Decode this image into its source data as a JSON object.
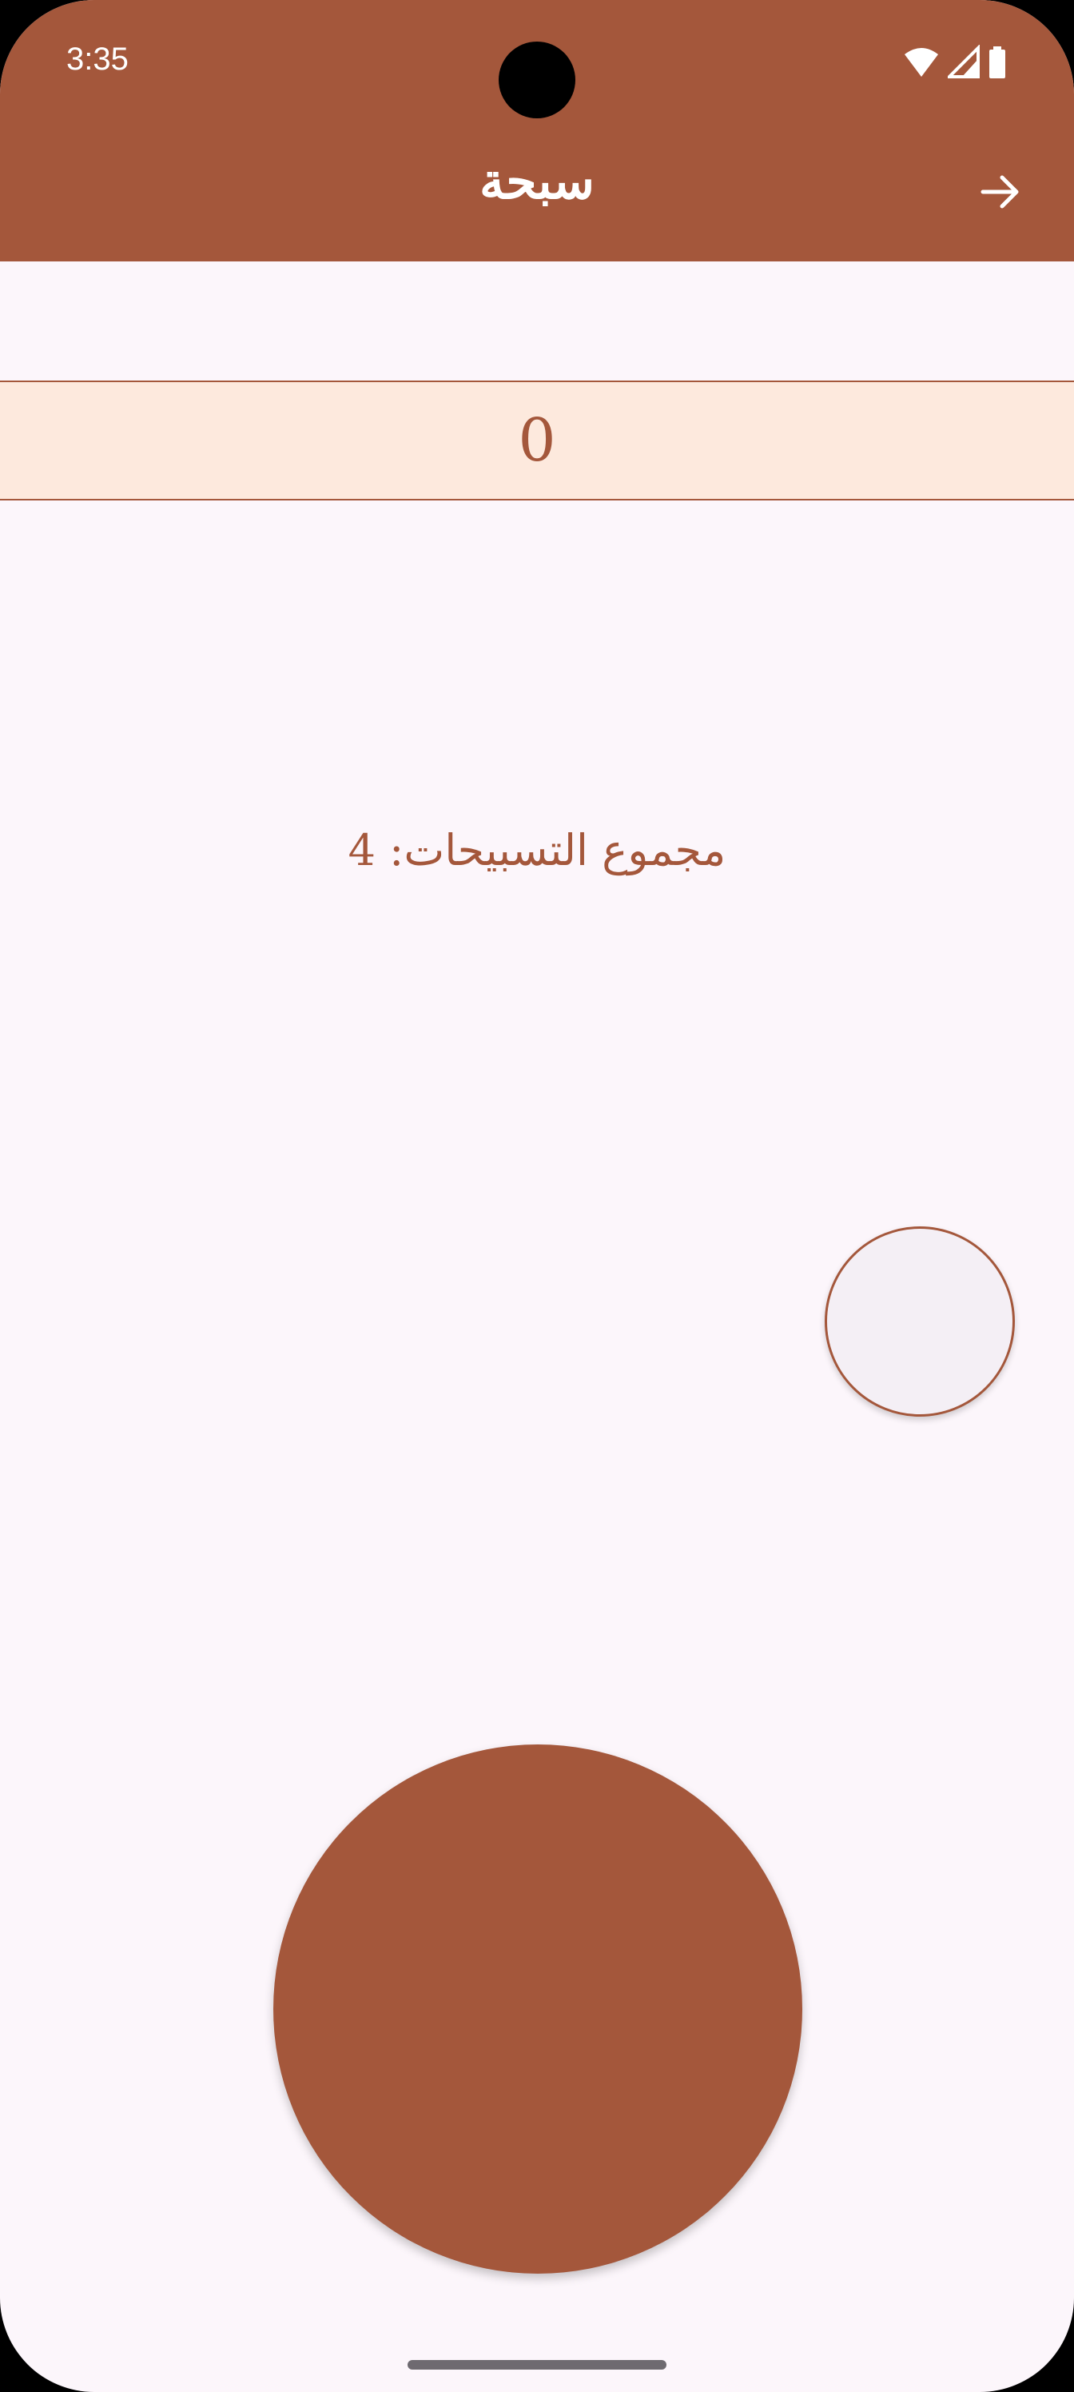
{
  "status_bar": {
    "time": "3:35",
    "icons": [
      "wifi-icon",
      "signal-icon",
      "battery-icon"
    ]
  },
  "app_bar": {
    "title": "سبحة",
    "back_icon": "arrow-right-icon"
  },
  "counter": {
    "value": "0"
  },
  "total": {
    "label": "مجموع التسبيحات: 4"
  },
  "colors": {
    "primary": "#a4573b",
    "counter_background": "#fde9dd",
    "page_background": "#fcf6fb",
    "reset_button_fill": "#f4eff5"
  }
}
